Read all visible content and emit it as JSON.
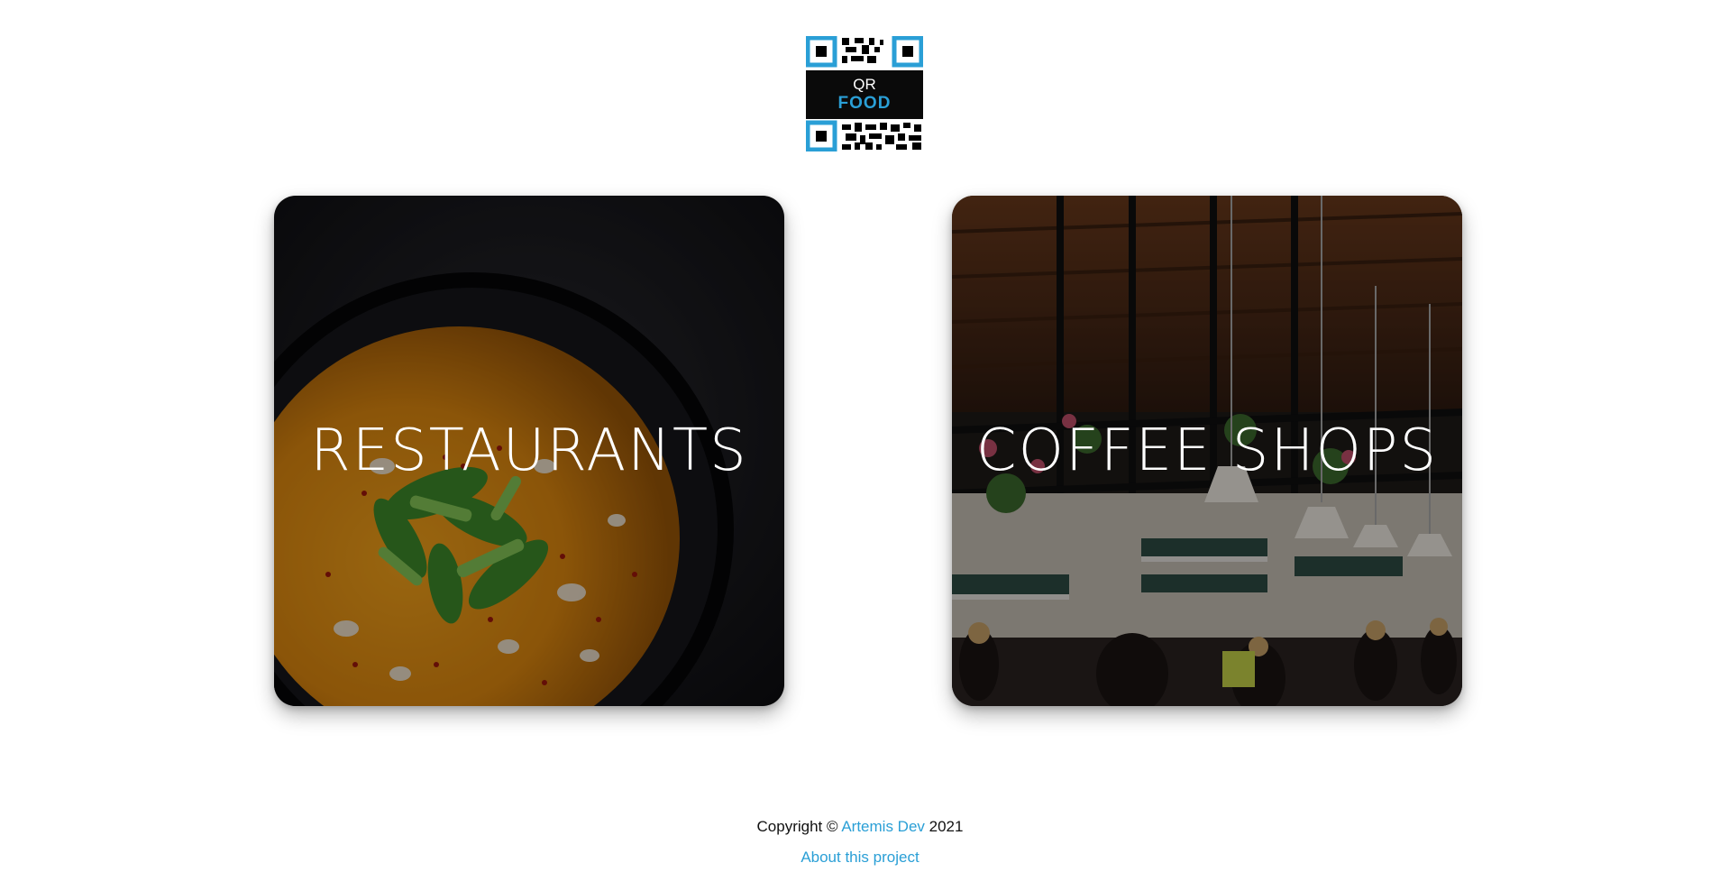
{
  "logo": {
    "top_text": "QR",
    "bottom_text": "FOOD",
    "accent_color": "#2a9fd6",
    "icon": "qr-food-logo-icon"
  },
  "cards": [
    {
      "title": "RESTAURANTS",
      "image": "soup-bowl-photo"
    },
    {
      "title": "COFFEE SHOPS",
      "image": "coffee-shop-interior-photo"
    }
  ],
  "footer": {
    "copyright_prefix": "Copyright ©",
    "author_link": "Artemis Dev",
    "year": "2021",
    "about_link": "About this project",
    "link_color": "#2a9fd6"
  }
}
